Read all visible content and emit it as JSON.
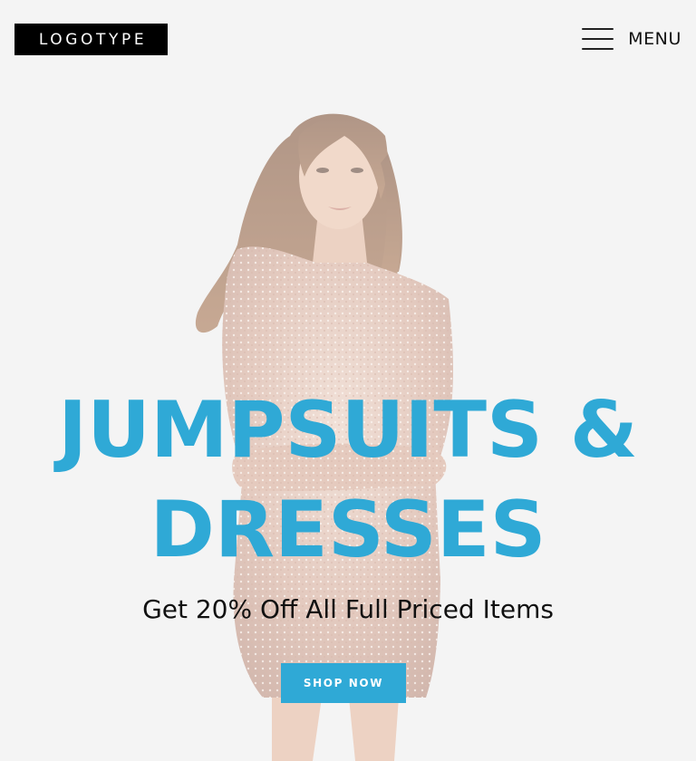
{
  "header": {
    "logo_text": "LOGOTYPE",
    "menu_label": "MENU",
    "menu_icon": "hamburger-menu-icon"
  },
  "hero": {
    "image": "model-in-sequin-dress",
    "headline_line1": "JUMPSUITS &",
    "headline_line2": "DRESSES",
    "subheadline": "Get 20% Off All Full Priced Items",
    "cta_label": "SHOP NOW"
  },
  "colors": {
    "accent": "#2fa9d6",
    "background": "#f4f4f4",
    "logo_bg": "#000000",
    "text": "#111111"
  }
}
